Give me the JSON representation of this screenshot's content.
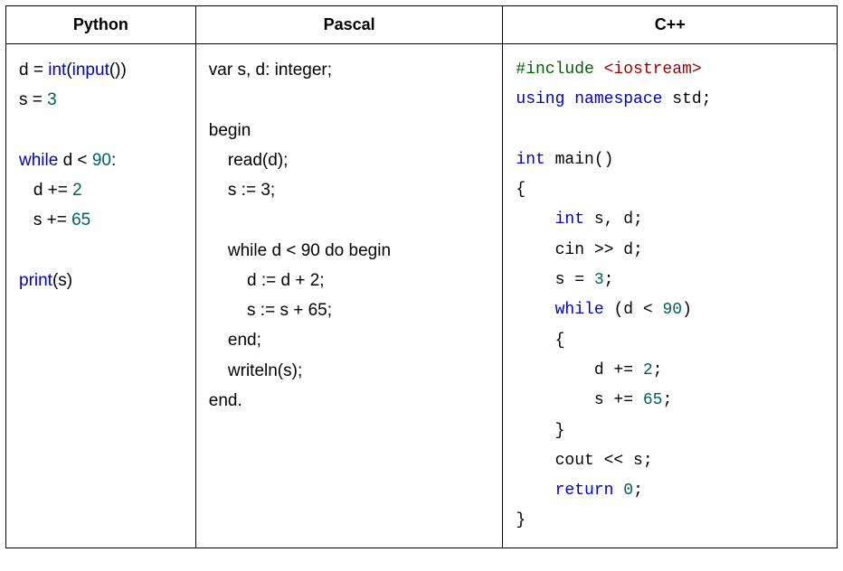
{
  "headers": {
    "python": "Python",
    "pascal": "Pascal",
    "cpp": "C++"
  },
  "python": {
    "l1a": "d = ",
    "l1b": "int",
    "l1c": "(",
    "l1d": "input",
    "l1e": "())",
    "l2a": "s = ",
    "l2b": "3",
    "l3a": "while",
    "l3b": " d < ",
    "l3c": "90",
    "l3d": ":",
    "l4a": "   d += ",
    "l4b": "2",
    "l5a": "   s += ",
    "l5b": "65",
    "l6a": "print",
    "l6b": "(s)"
  },
  "pascal": {
    "l1": "var s, d: integer;",
    "l2": "begin",
    "l3": "    read(d);",
    "l4": "    s := 3;",
    "l5": "    while d < 90 do begin",
    "l6": "        d := d + 2;",
    "l7": "        s := s + 65;",
    "l8": "    end;",
    "l9": "    writeln(s);",
    "l10": "end."
  },
  "cpp": {
    "l1a": "#include ",
    "l1b": "<iostream>",
    "l2a": "using",
    "l2b": " ",
    "l2c": "namespace",
    "l2d": " std;",
    "l3a": "int",
    "l3b": " main()",
    "l4": "{",
    "l5a": "    ",
    "l5b": "int",
    "l5c": " s, d;",
    "l6": "    cin >> d;",
    "l7a": "    s = ",
    "l7b": "3",
    "l7c": ";",
    "l8a": "    ",
    "l8b": "while",
    "l8c": " (d < ",
    "l8d": "90",
    "l8e": ")",
    "l9": "    {",
    "l10a": "        d += ",
    "l10b": "2",
    "l10c": ";",
    "l11a": "        s += ",
    "l11b": "65",
    "l11c": ";",
    "l12": "    }",
    "l13": "    cout << s;",
    "l14a": "    ",
    "l14b": "return",
    "l14c": " ",
    "l14d": "0",
    "l14e": ";",
    "l15": "}"
  }
}
